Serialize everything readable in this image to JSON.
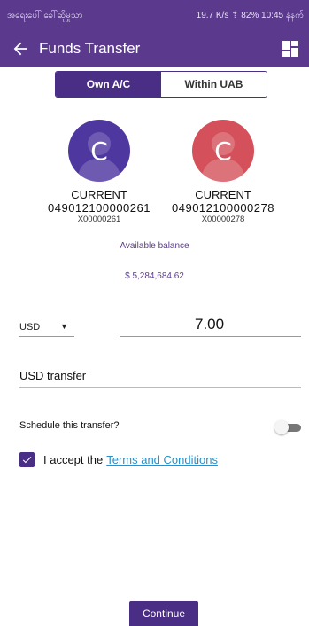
{
  "status_bar": {
    "left_text": "အရေးပေါ် ခေါ်ဆိုမှုသာ",
    "right_text": "19.7 K/s ⇡ 82% 10:45 နံနက်"
  },
  "app_bar": {
    "title": "Funds Transfer",
    "back_icon": "arrow-left-icon",
    "right_icon": "dashboard-grid-icon"
  },
  "segment": {
    "tabs": [
      {
        "label": "Own A/C",
        "active": true
      },
      {
        "label": "Within UAB",
        "active": false
      }
    ]
  },
  "accounts": [
    {
      "avatar_letter": "C",
      "type": "CURRENT",
      "number": "049012100000261",
      "code": "X00000261",
      "color": "#4f37a0"
    },
    {
      "avatar_letter": "C",
      "type": "CURRENT",
      "number": "049012100000278",
      "code": "X00000278",
      "color": "#d4505a"
    }
  ],
  "balance": {
    "label": "Available balance",
    "value": "$ 5,284,684.62"
  },
  "transfer": {
    "currency": "USD",
    "amount": "7.00",
    "remark": "USD transfer"
  },
  "schedule": {
    "label": "Schedule this transfer?",
    "enabled": false
  },
  "accept": {
    "checked": true,
    "text": "I accept the",
    "link_text": "Terms and Conditions"
  },
  "continue_label": "Continue",
  "colors": {
    "primary": "#5b3a8e",
    "primary_dark": "#4a2d85",
    "link": "#2a8ec7"
  }
}
